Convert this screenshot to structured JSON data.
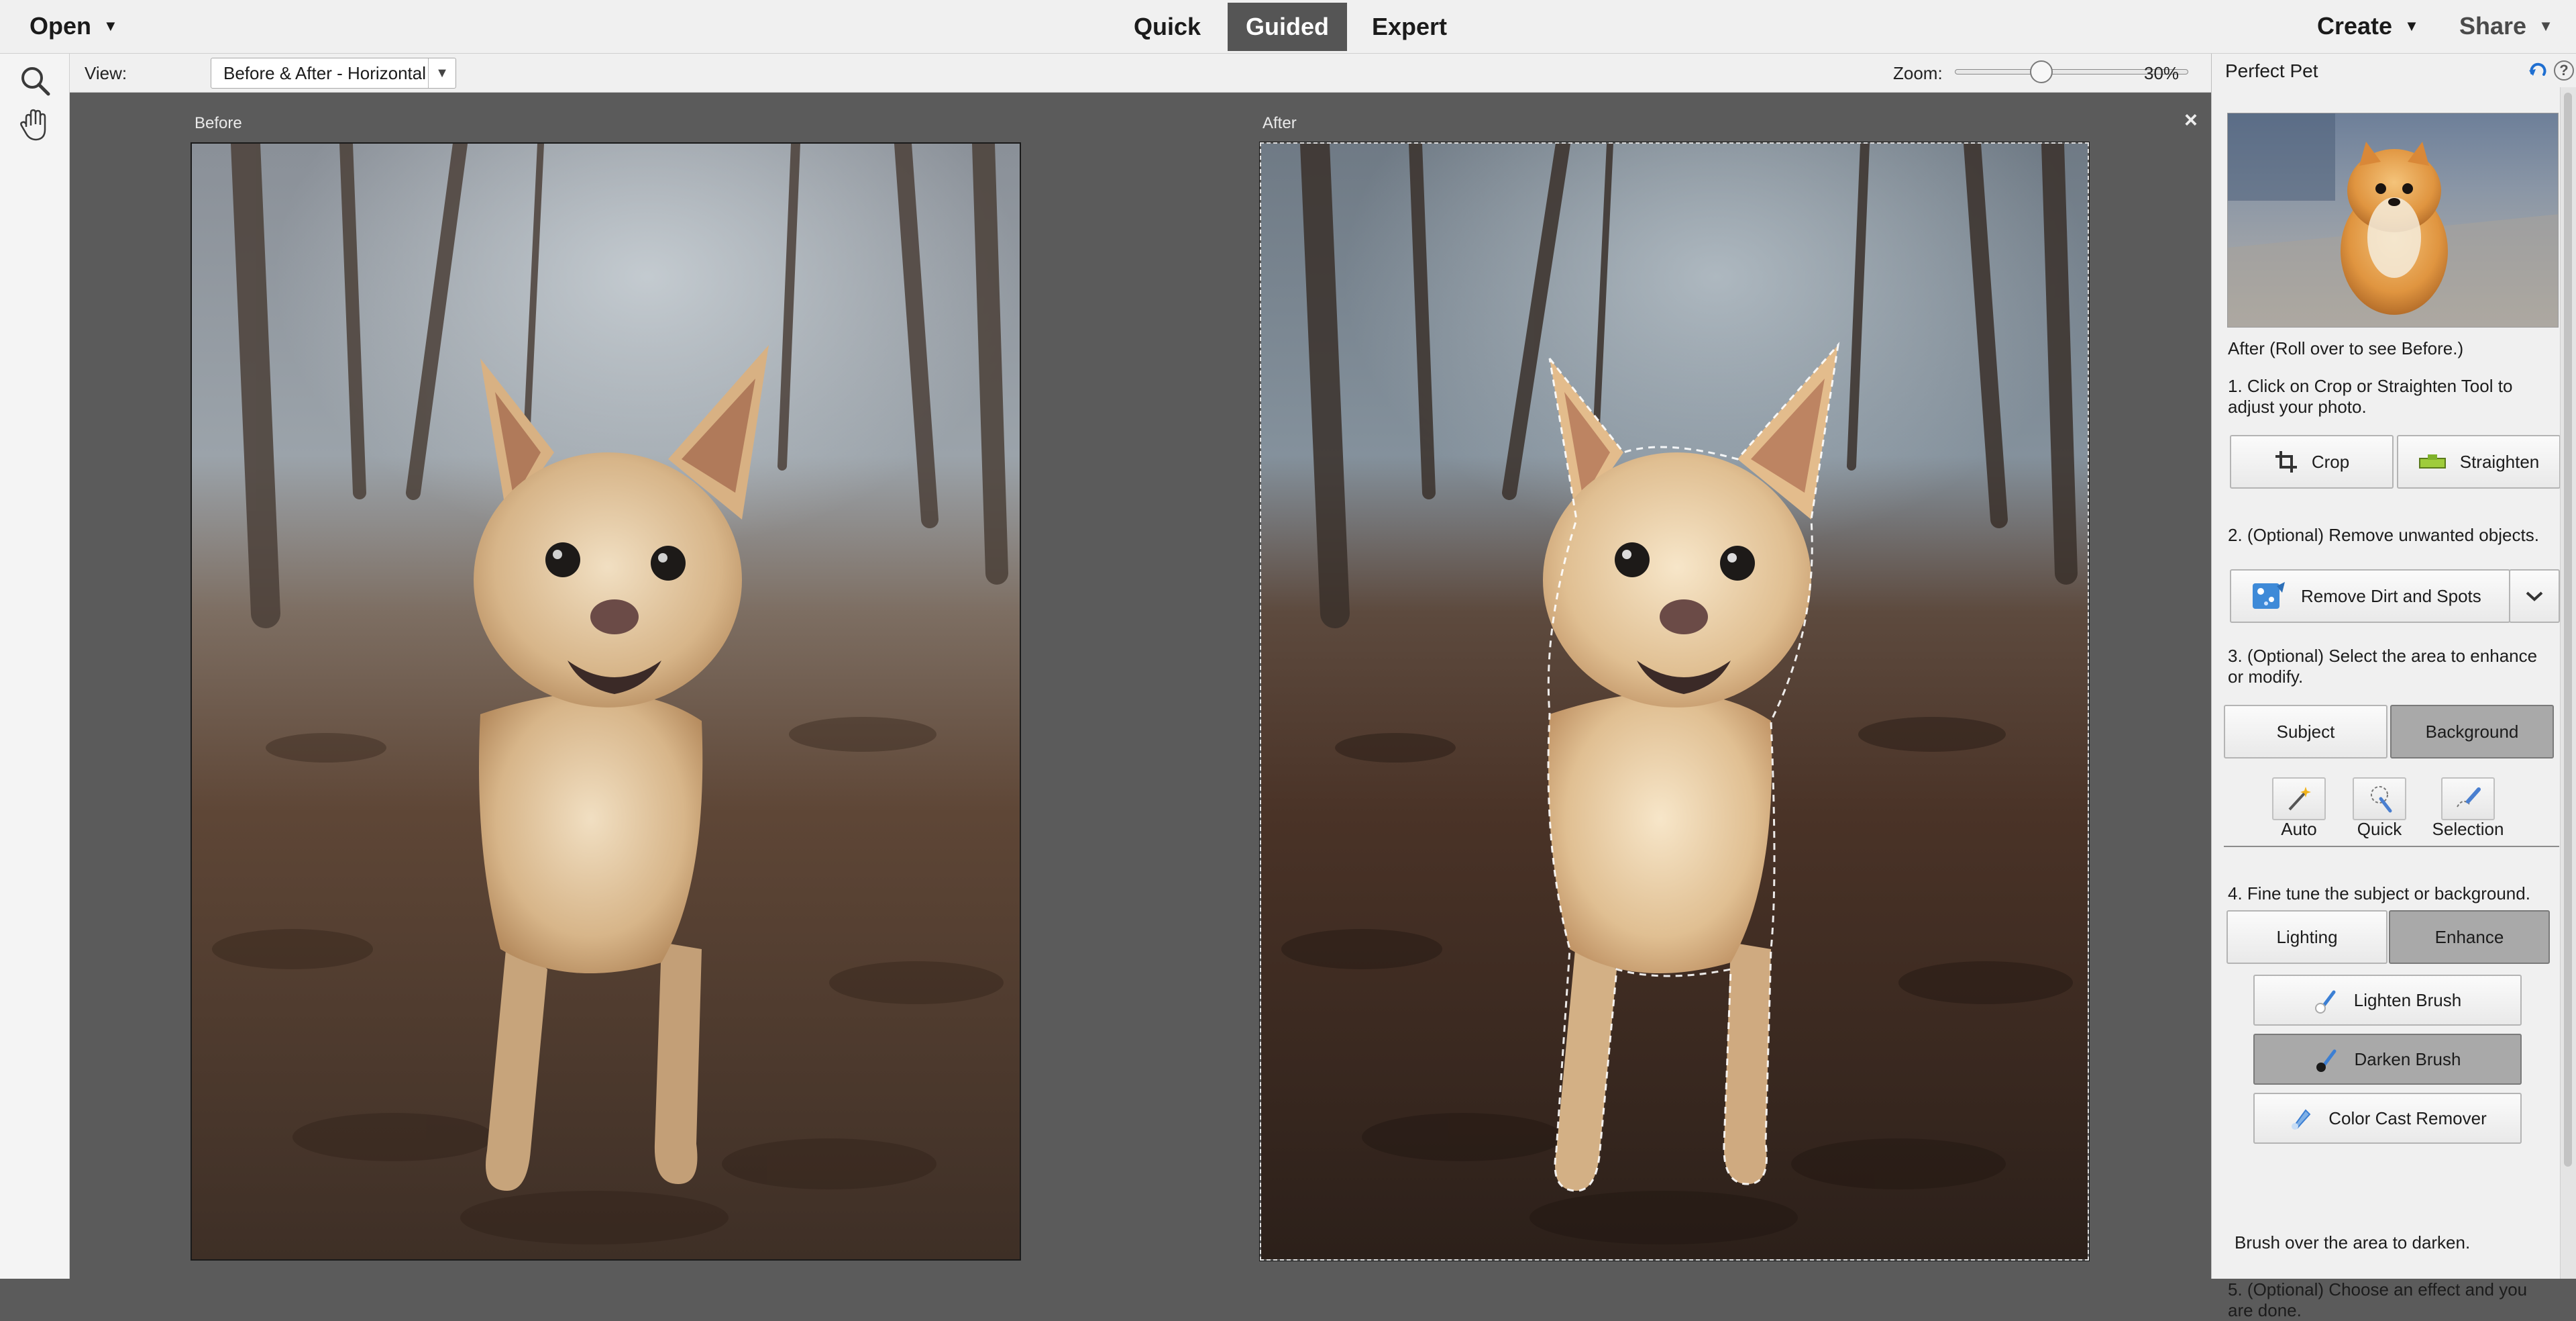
{
  "topbar": {
    "open_label": "Open",
    "mode_tabs": [
      {
        "label": "Quick"
      },
      {
        "label": "Guided"
      },
      {
        "label": "Expert"
      }
    ],
    "create_label": "Create",
    "share_label": "Share"
  },
  "options": {
    "view_label": "View:",
    "view_value": "Before & After - Horizontal",
    "zoom_label": "Zoom:",
    "zoom_value": "30%"
  },
  "canvas": {
    "before_label": "Before",
    "after_label": "After",
    "close_glyph": "×"
  },
  "panel": {
    "title": "Perfect Pet",
    "preview_caption": "After (Roll over to see Before.)",
    "step1": "1. Click on Crop or Straighten Tool to adjust your photo.",
    "crop_label": "Crop",
    "straighten_label": "Straighten",
    "step2": "2. (Optional) Remove unwanted objects.",
    "remove_label": "Remove Dirt and Spots",
    "step3": "3. (Optional) Select the area to enhance or modify.",
    "subject_label": "Subject",
    "background_label": "Background",
    "select_tools": [
      {
        "label": "Auto"
      },
      {
        "label": "Quick"
      },
      {
        "label": "Selection"
      }
    ],
    "step4": "4. Fine tune the subject or background.",
    "lighting_label": "Lighting",
    "enhance_label": "Enhance",
    "brushes": [
      {
        "label": "Lighten Brush"
      },
      {
        "label": "Darken Brush"
      },
      {
        "label": "Color Cast Remover"
      }
    ],
    "hint": "Brush over the area to darken.",
    "step5": "5. (Optional) Choose an effect and you are done."
  }
}
